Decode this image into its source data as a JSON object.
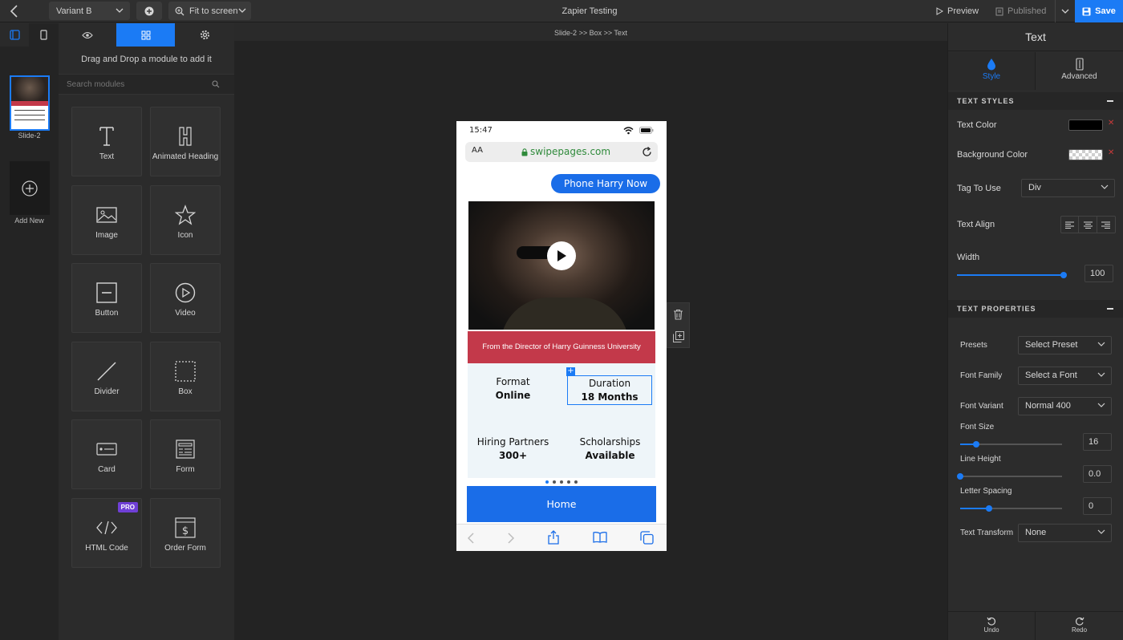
{
  "topbar": {
    "variant": "Variant B",
    "zoom": "Fit to screen",
    "title": "Zapier Testing",
    "preview": "Preview",
    "published": "Published",
    "save": "Save"
  },
  "slides": {
    "current_label": "Slide-2",
    "add_new": "Add New"
  },
  "modules": {
    "hint": "Drag and Drop a module to add it",
    "search_placeholder": "Search modules",
    "pro_badge": "PRO",
    "items": [
      {
        "label": "Text",
        "icon": "text-icon"
      },
      {
        "label": "Animated Heading",
        "icon": "animated-heading-icon"
      },
      {
        "label": "Image",
        "icon": "image-icon"
      },
      {
        "label": "Icon",
        "icon": "star-icon"
      },
      {
        "label": "Button",
        "icon": "button-icon"
      },
      {
        "label": "Video",
        "icon": "play-circle-icon"
      },
      {
        "label": "Divider",
        "icon": "divider-icon"
      },
      {
        "label": "Box",
        "icon": "box-icon"
      },
      {
        "label": "Card",
        "icon": "card-icon"
      },
      {
        "label": "Form",
        "icon": "form-icon"
      },
      {
        "label": "HTML Code",
        "icon": "code-icon"
      },
      {
        "label": "Order Form",
        "icon": "order-form-icon"
      }
    ]
  },
  "breadcrumb": "Slide-2 >> Box >> Text",
  "phone": {
    "time": "15:47",
    "font_size_glyph": "AA",
    "url": "swipepages.com",
    "cta": "Phone Harry Now",
    "banner": "From the Director of Harry Guinness University",
    "stats": [
      {
        "label": "Format",
        "value": "Online"
      },
      {
        "label": "Duration",
        "value": "18 Months"
      },
      {
        "label": "Hiring Partners",
        "value": "300+"
      },
      {
        "label": "Scholarships",
        "value": "Available"
      }
    ],
    "home": "Home"
  },
  "right_panel": {
    "title": "Text",
    "tab_style": "Style",
    "tab_advanced": "Advanced",
    "text_styles_header": "TEXT STYLES",
    "text_color_label": "Text Color",
    "text_color": "#000000",
    "bg_color_label": "Background Color",
    "tag_label": "Tag To Use",
    "tag_value": "Div",
    "align_label": "Text Align",
    "width_label": "Width",
    "width_value": "100",
    "text_props_header": "TEXT PROPERTIES",
    "presets_label": "Presets",
    "presets_value": "Select Preset",
    "font_family_label": "Font Family",
    "font_family_value": "Select a Font",
    "font_variant_label": "Font Variant",
    "font_variant_value": "Normal 400",
    "font_size_label": "Font Size",
    "font_size_value": "16",
    "line_height_label": "Line Height",
    "line_height_value": "0.0",
    "letter_spacing_label": "Letter Spacing",
    "letter_spacing_value": "0",
    "text_transform_label": "Text Transform",
    "text_transform_value": "None",
    "undo": "Undo",
    "redo": "Redo"
  },
  "colors": {
    "accent": "#1b7bf5",
    "banner": "#c3394a",
    "cta": "#1a6de8"
  }
}
